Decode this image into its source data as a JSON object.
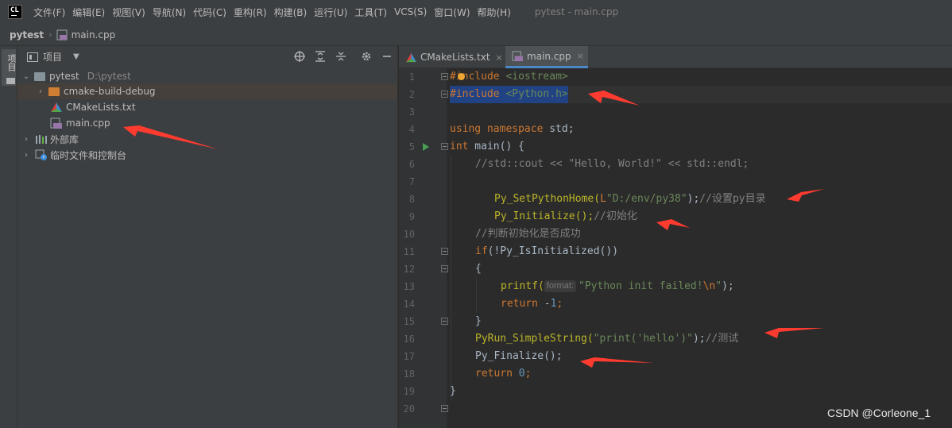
{
  "app": {
    "logo_text": "CL",
    "window_title": "pytest - main.cpp",
    "menu": [
      "文件(F)",
      "编辑(E)",
      "视图(V)",
      "导航(N)",
      "代码(C)",
      "重构(R)",
      "构建(B)",
      "运行(U)",
      "工具(T)",
      "VCS(S)",
      "窗口(W)",
      "帮助(H)"
    ]
  },
  "breadcrumb": {
    "project": "pytest",
    "file": "main.cpp"
  },
  "tool_strip": {
    "label": "项目"
  },
  "project_panel": {
    "title": "项目",
    "tree": [
      {
        "label": "pytest",
        "hint": "D:\\pytest",
        "icon": "folder-icon"
      },
      {
        "label": "cmake-build-debug",
        "icon": "folder-orange-icon"
      },
      {
        "label": "CMakeLists.txt",
        "icon": "cmake-icon"
      },
      {
        "label": "main.cpp",
        "icon": "cpp-file-icon"
      },
      {
        "label": "外部库",
        "icon": "library-icon"
      },
      {
        "label": "临时文件和控制台",
        "icon": "scratch-icon"
      }
    ]
  },
  "editor": {
    "tabs": [
      {
        "label": "CMakeLists.txt",
        "close": "×",
        "active": false
      },
      {
        "label": "main.cpp",
        "close": "×",
        "active": true
      }
    ],
    "line_numbers": [
      "1",
      "2",
      "3",
      "4",
      "5",
      "6",
      "7",
      "8",
      "9",
      "10",
      "11",
      "12",
      "13",
      "14",
      "15",
      "16",
      "17",
      "18",
      "19",
      "20"
    ],
    "code": {
      "l1_directive": "#include",
      "l1_header": "<iostream>",
      "l2_directive": "#include",
      "l2_header": "<Python.h>",
      "l4_kw": "using namespace",
      "l4_rest": " std;",
      "l5_kw": "int",
      "l5_rest": " main() {",
      "l6_comment": "//std::cout << \"Hello, World!\" << std::endl;",
      "l8_fn": "Py_SetPythonHome(",
      "l8_prefix": "L",
      "l8_str": "\"D:/env/py38\"",
      "l8_close": ");",
      "l8_comment": "//设置py目录",
      "l9_fn": "Py_Initialize();",
      "l9_comment": "//初始化",
      "l10_comment": "//判断初始化是否成功",
      "l11_kw": "if",
      "l11_rest": "(!Py_IsInitialized())",
      "l12": "{",
      "l13_fn": "printf(",
      "l13_hint": "format:",
      "l13_str": "\"Python init failed!",
      "l13_esc": "\\n",
      "l13_str_end": "\"",
      "l13_close": ");",
      "l14_kw": "return",
      "l14_rest": " -",
      "l14_num": "1",
      "l14_end": ";",
      "l15": "}",
      "l16_fn": "PyRun_SimpleString(",
      "l16_str": "\"print('hello')\"",
      "l16_close": ");",
      "l16_comment": "//测试",
      "l17_fn": "Py_Finalize();",
      "l18_kw": "return",
      "l18_num": "0",
      "l18_end": ";",
      "l19": "}"
    }
  },
  "watermark": "CSDN @Corleone_1",
  "colors": {
    "background": "#2b2b2b",
    "panel": "#3c3f41",
    "keyword": "#cc7832",
    "string": "#6a8759",
    "comment": "#808080",
    "number": "#6897bb",
    "annotation_arrow": "#ff3b30",
    "selection": "#214283"
  }
}
